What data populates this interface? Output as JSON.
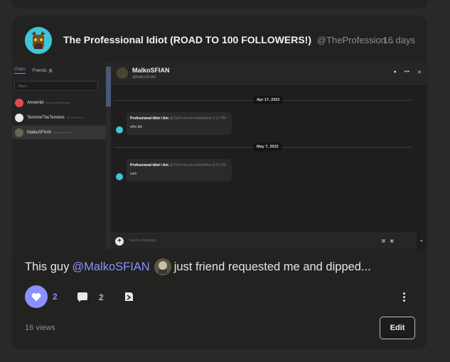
{
  "post": {
    "title": "The Professional Idiot (ROAD TO 100 FOLLOWERS!)",
    "handle": "@TheProfession...",
    "time": "16 days",
    "caption_pre": "This guy",
    "mention": "@MalkoSFIAN",
    "caption_post": "just friend requested me and dipped...",
    "likes": "2",
    "comments": "2",
    "views": "16 views",
    "edit_label": "Edit"
  },
  "screenshot": {
    "tabs": {
      "chats": "Chats",
      "friends": "Friends",
      "friends_count": "3"
    },
    "filter_placeholder": "Filter...",
    "contacts": [
      {
        "name": "Annembi",
        "handle": "@AnnembiWaddle"
      },
      {
        "name": "TemmieTheTemtem",
        "handle": "@TemmieThe..."
      },
      {
        "name": "MalkoSFIAN",
        "handle": "@MalkoSFIAN"
      }
    ],
    "chat": {
      "name": "MalkoSFIAN",
      "handle": "@MalkoSFIAN",
      "messages": [
        {
          "date": "Apr 17, 2022",
          "author": "Professional Idiot I Am",
          "author_handle": "@TheProfessionalIdiotIAm",
          "time": "2:17 PM",
          "text": "who dis"
        },
        {
          "date": "May 7, 2022",
          "author": "Professional Idiot I Am",
          "author_handle": "@TheProfessionalIdiotIAm",
          "time": "8:43 PM",
          "text": "cum"
        }
      ],
      "send_placeholder": "Send a message"
    }
  },
  "colors": {
    "accent": "#8a91ff",
    "card": "#222220",
    "background": "#292927"
  },
  "icons": [
    "heart-icon",
    "comment-icon",
    "share-icon",
    "more-vertical-icon",
    "plus-icon",
    "close-icon"
  ]
}
